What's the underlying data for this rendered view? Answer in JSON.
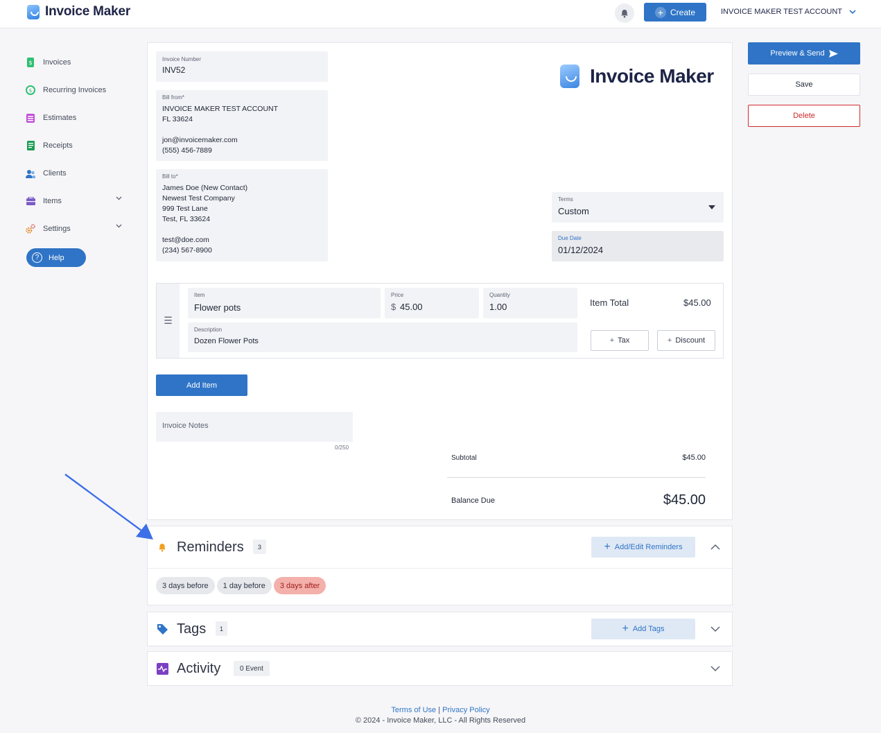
{
  "app": {
    "brand": "Invoice Maker",
    "create_label": "Create",
    "account_name": "INVOICE MAKER TEST ACCOUNT"
  },
  "sidebar": {
    "items": [
      {
        "label": "Invoices",
        "icon": "invoice-icon",
        "color": "#2fbf71"
      },
      {
        "label": "Recurring Invoices",
        "icon": "recurring-icon",
        "color": "#2fbf71"
      },
      {
        "label": "Estimates",
        "icon": "estimates-icon",
        "color": "#c14fd6"
      },
      {
        "label": "Receipts",
        "icon": "receipts-icon",
        "color": "#1f9d55"
      },
      {
        "label": "Clients",
        "icon": "clients-icon",
        "color": "#2f74c6"
      },
      {
        "label": "Items",
        "icon": "items-icon",
        "color": "#7b5cc7"
      },
      {
        "label": "Settings",
        "icon": "settings-icon",
        "color": "#e08b2a"
      }
    ],
    "help_label": "Help"
  },
  "invoice": {
    "number_label": "Invoice Number",
    "number": "INV52",
    "bill_from_label": "Bill from*",
    "bill_from": [
      "INVOICE MAKER TEST ACCOUNT",
      "FL 33624",
      "",
      "jon@invoicemaker.com",
      "(555) 456-7889"
    ],
    "bill_to_label": "Bill to*",
    "bill_to": [
      "James Doe (New Contact)",
      "Newest Test Company",
      "999 Test Lane",
      "Test, FL 33624",
      "",
      "test@doe.com",
      "(234) 567-8900"
    ],
    "logo_text": "Invoice Maker",
    "terms_label": "Terms",
    "terms": "Custom",
    "due_date_label": "Due Date",
    "due_date": "01/12/2024"
  },
  "line_item": {
    "item_label": "Item",
    "item": "Flower pots",
    "price_label": "Price",
    "currency": "$",
    "price": "45.00",
    "quantity_label": "Quantity",
    "quantity": "1.00",
    "description_label": "Description",
    "description": "Dozen Flower Pots",
    "total_label": "Item Total",
    "total": "$45.00",
    "tax_label": "Tax",
    "discount_label": "Discount"
  },
  "add_item_label": "Add Item",
  "notes": {
    "placeholder": "Invoice Notes",
    "count": "0/250"
  },
  "summary": {
    "subtotal_label": "Subtotal",
    "subtotal": "$45.00",
    "balance_label": "Balance Due",
    "balance": "$45.00"
  },
  "actions": {
    "preview_send": "Preview & Send",
    "save": "Save",
    "delete": "Delete"
  },
  "reminders": {
    "title": "Reminders",
    "count": "3",
    "button": "Add/Edit Reminders",
    "pills": [
      {
        "label": "3 days before",
        "bg": "#e6e8ec",
        "color": "#2e3444"
      },
      {
        "label": "1 day before",
        "bg": "#e6e8ec",
        "color": "#2e3444"
      },
      {
        "label": "3 days after",
        "bg": "#f4b0ab",
        "color": "#9b1c1c"
      }
    ]
  },
  "tags": {
    "title": "Tags",
    "count": "1",
    "button": "Add Tags"
  },
  "activity": {
    "title": "Activity",
    "count": "0 Event"
  },
  "footer": {
    "terms": "Terms of Use",
    "separator": "|",
    "privacy": "Privacy Policy",
    "copyright": "© 2024 - Invoice Maker, LLC - All Rights Reserved"
  }
}
